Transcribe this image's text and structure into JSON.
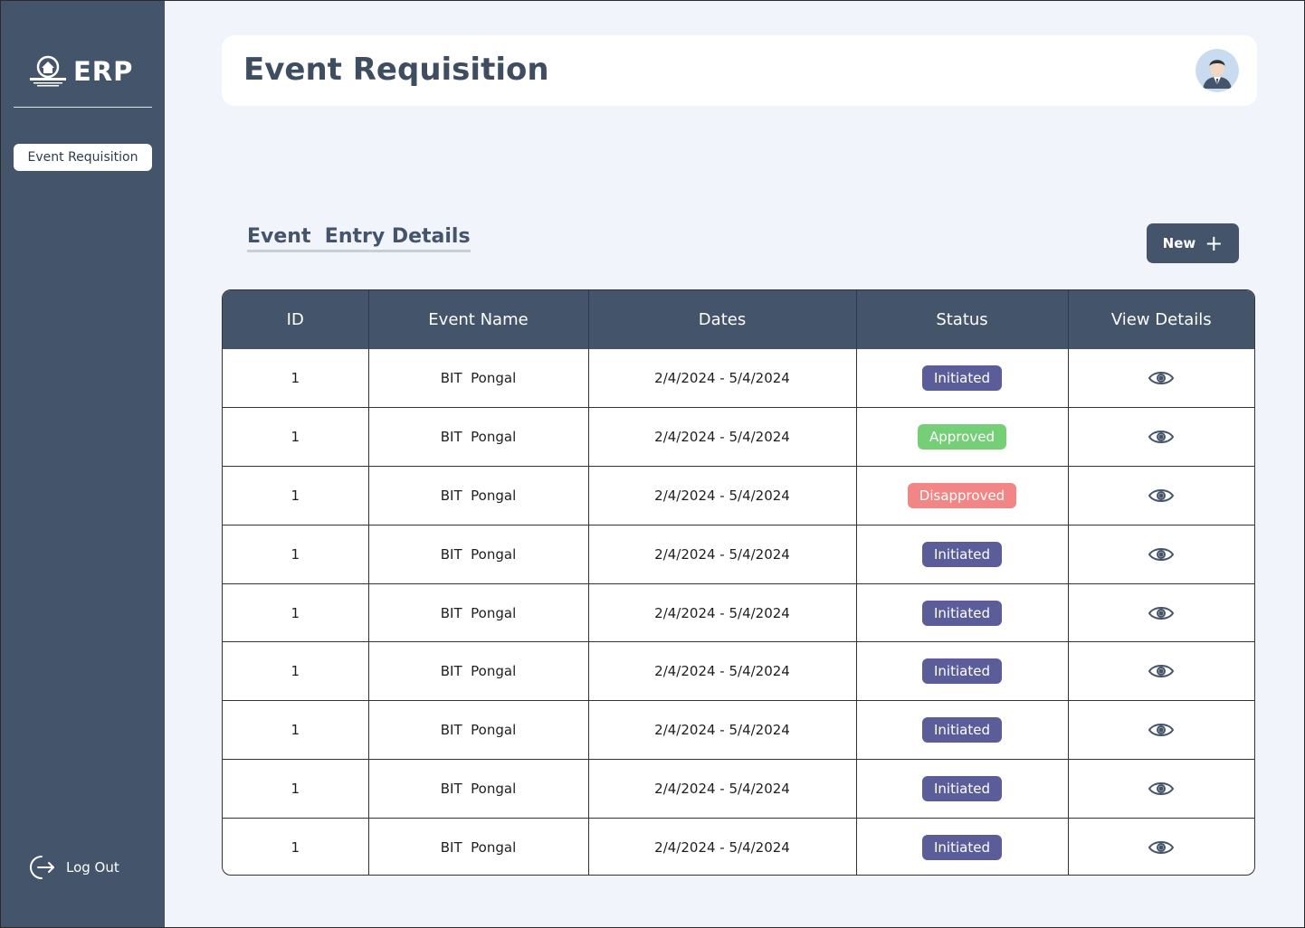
{
  "app": {
    "logo_text": "ERP",
    "logo_emblem_name": "institute-emblem"
  },
  "sidebar": {
    "items": [
      {
        "label": "Event Requisition",
        "active": true
      }
    ],
    "logout_label": "Log Out",
    "logout_icon": "logout-icon"
  },
  "header": {
    "title": "Event Requisition",
    "avatar_icon": "user-avatar"
  },
  "section": {
    "title": "Event  Entry Details",
    "new_button_label": "New",
    "new_button_icon": "plus-icon"
  },
  "table": {
    "columns": [
      "ID",
      "Event Name",
      "Dates",
      "Status",
      "View Details"
    ],
    "rows": [
      {
        "id": "1",
        "event_name": "BIT  Pongal",
        "dates": "2/4/2024 - 5/4/2024",
        "status": "Initiated"
      },
      {
        "id": "1",
        "event_name": "BIT  Pongal",
        "dates": "2/4/2024 - 5/4/2024",
        "status": "Approved"
      },
      {
        "id": "1",
        "event_name": "BIT  Pongal",
        "dates": "2/4/2024 - 5/4/2024",
        "status": "Disapproved"
      },
      {
        "id": "1",
        "event_name": "BIT  Pongal",
        "dates": "2/4/2024 - 5/4/2024",
        "status": "Initiated"
      },
      {
        "id": "1",
        "event_name": "BIT  Pongal",
        "dates": "2/4/2024 - 5/4/2024",
        "status": "Initiated"
      },
      {
        "id": "1",
        "event_name": "BIT  Pongal",
        "dates": "2/4/2024 - 5/4/2024",
        "status": "Initiated"
      },
      {
        "id": "1",
        "event_name": "BIT  Pongal",
        "dates": "2/4/2024 - 5/4/2024",
        "status": "Initiated"
      },
      {
        "id": "1",
        "event_name": "BIT  Pongal",
        "dates": "2/4/2024 - 5/4/2024",
        "status": "Initiated"
      },
      {
        "id": "1",
        "event_name": "BIT  Pongal",
        "dates": "2/4/2024 - 5/4/2024",
        "status": "Initiated"
      }
    ],
    "view_icon": "eye-icon"
  },
  "colors": {
    "sidebar_bg": "#44546a",
    "page_bg": "#f1f4fb",
    "status_initiated": "#5b5d9a",
    "status_approved": "#74cf76",
    "status_disapproved": "#f28585"
  }
}
